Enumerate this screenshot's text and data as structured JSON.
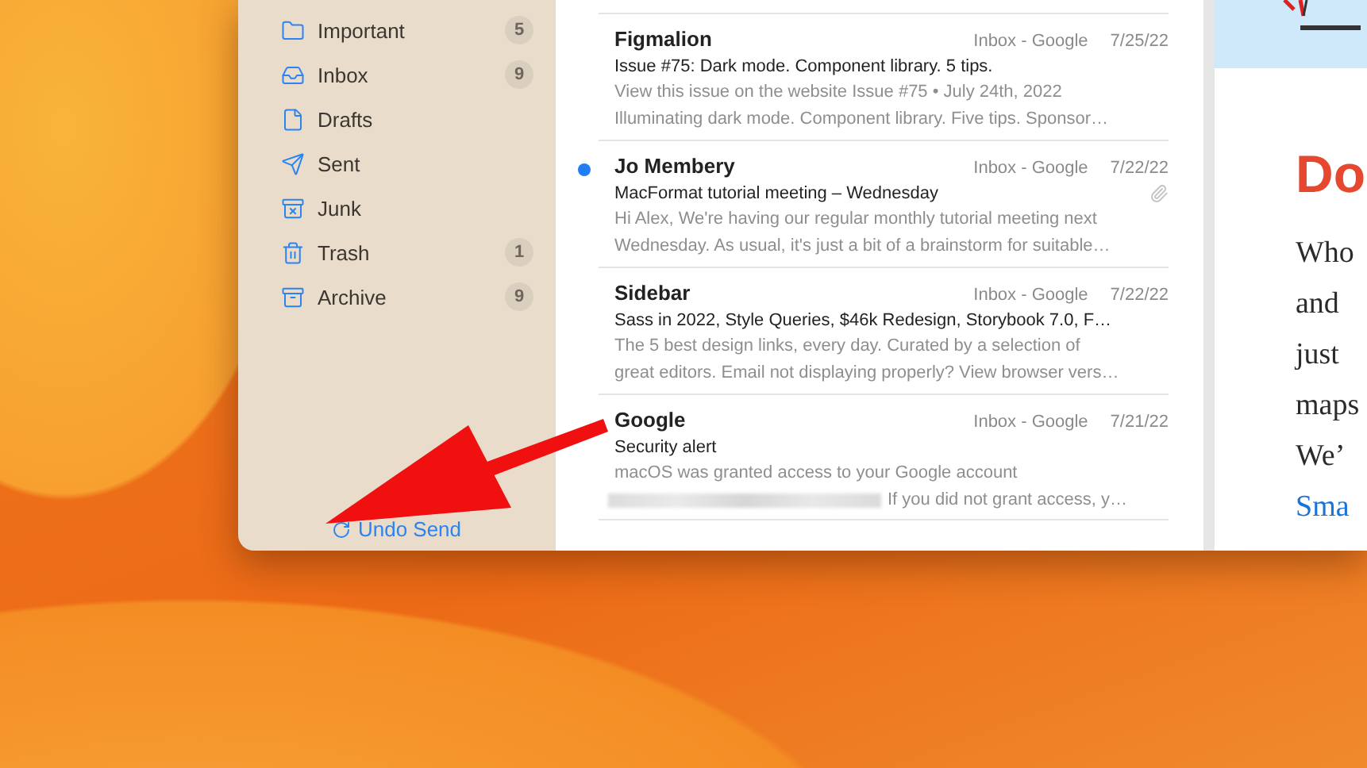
{
  "sidebar": {
    "items": [
      {
        "label": "Important",
        "count": "5",
        "kind": "folder"
      },
      {
        "label": "Inbox",
        "count": "9",
        "kind": "inbox"
      },
      {
        "label": "Drafts",
        "kind": "draft"
      },
      {
        "label": "Sent",
        "kind": "sent"
      },
      {
        "label": "Junk",
        "kind": "junk"
      },
      {
        "label": "Trash",
        "count": "1",
        "kind": "trash"
      },
      {
        "label": "Archive",
        "count": "9",
        "kind": "archive"
      }
    ],
    "undo_send": "Undo Send"
  },
  "messages": [
    {
      "sender": "Figmalion",
      "mailbox": "Inbox - Google",
      "date": "7/25/22",
      "unread": false,
      "attachment": false,
      "subject": "Issue #75: Dark mode. Component library. 5 tips.",
      "preview": [
        {
          "text": "View this issue on the website Issue #75  •  July 24th, 2022",
          "redacted": false
        },
        {
          "text": "Illuminating dark mode. Component library. Five tips.   Sponsor…",
          "redacted": false
        }
      ]
    },
    {
      "sender": "Jo Membery",
      "mailbox": "Inbox - Google",
      "date": "7/22/22",
      "unread": true,
      "attachment": true,
      "subject": "MacFormat tutorial meeting – Wednesday",
      "preview": [
        {
          "text": "Hi Alex, We're having our regular monthly tutorial meeting next",
          "redacted": false
        },
        {
          "text": "Wednesday. As usual, it's just a bit of a brainstorm for suitable…",
          "redacted": false
        }
      ]
    },
    {
      "sender": "Sidebar",
      "mailbox": "Inbox - Google",
      "date": "7/22/22",
      "unread": false,
      "attachment": false,
      "subject": "Sass in 2022, Style Queries, $46k Redesign, Storybook 7.0, F…",
      "preview": [
        {
          "text": "The 5 best design links, every day. Curated by a selection of",
          "redacted": false
        },
        {
          "text": "great editors. Email not displaying properly? View browser vers…",
          "redacted": false
        }
      ]
    },
    {
      "sender": "Google",
      "mailbox": "Inbox - Google",
      "date": "7/21/22",
      "unread": false,
      "attachment": false,
      "subject": "Security alert",
      "preview": [
        {
          "text": "macOS was granted access to your Google account",
          "redacted": false
        },
        {
          "text": "If you did not grant access, y…",
          "redacted": true
        }
      ]
    }
  ],
  "reader": {
    "heading": "Do",
    "lines": [
      "Who",
      "and",
      "just",
      "maps",
      "We’"
    ],
    "link": "Sma"
  }
}
